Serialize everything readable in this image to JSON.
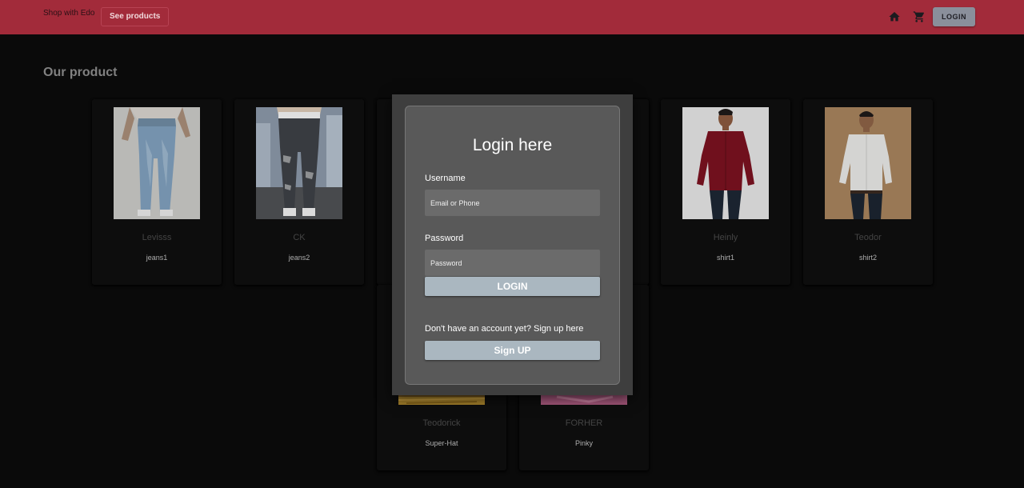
{
  "header": {
    "brand": "Shop with Edo",
    "see_products": "See products",
    "login": "LOGIN"
  },
  "page": {
    "title": "Our product"
  },
  "products": [
    {
      "brand": "Levisss",
      "name": "jeans1",
      "icon": "jeans-photo"
    },
    {
      "brand": "CK",
      "name": "jeans2",
      "icon": "ripped-jeans-photo"
    },
    {
      "brand": "",
      "name": "",
      "icon": "hidden-product"
    },
    {
      "brand": "",
      "name": "",
      "icon": "hidden-product"
    },
    {
      "brand": "Heinly",
      "name": "shirt1",
      "icon": "red-shirt-photo"
    },
    {
      "brand": "Teodor",
      "name": "shirt2",
      "icon": "white-shirt-photo"
    },
    {
      "brand": "Teodorick",
      "name": "Super-Hat",
      "icon": "hat-photo"
    },
    {
      "brand": "FORHER",
      "name": "Pinky",
      "icon": "pink-item-photo"
    }
  ],
  "login_modal": {
    "title": "Login here",
    "username_label": "Username",
    "username_placeholder": "Email or Phone",
    "password_label": "Password",
    "password_placeholder": "Password",
    "login_button": "LOGIN",
    "signup_prompt": "Don't have an account yet? Sign up here",
    "signup_button": "Sign UP"
  },
  "colors": {
    "header": "#a22b3a",
    "background": "#0b0b0b",
    "modal": "#595959",
    "button": "#aab7c0"
  }
}
